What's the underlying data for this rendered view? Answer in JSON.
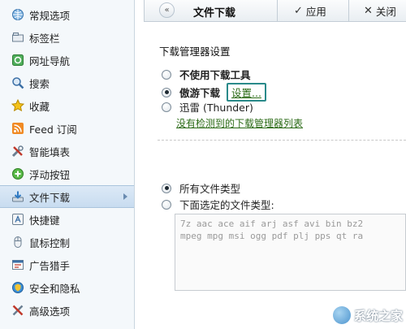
{
  "sidebar": {
    "items": [
      {
        "label": "常规选项",
        "icon": "globe-icon"
      },
      {
        "label": "标签栏",
        "icon": "tab-icon"
      },
      {
        "label": "网址导航",
        "icon": "navigation-icon"
      },
      {
        "label": "搜索",
        "icon": "search-icon"
      },
      {
        "label": "收藏",
        "icon": "star-icon"
      },
      {
        "label": "Feed 订阅",
        "icon": "rss-icon"
      },
      {
        "label": "智能填表",
        "icon": "tools-icon"
      },
      {
        "label": "浮动按钮",
        "icon": "plus-circle-icon"
      },
      {
        "label": "文件下载",
        "icon": "download-icon",
        "active": true
      },
      {
        "label": "快捷键",
        "icon": "keyboard-icon"
      },
      {
        "label": "鼠标控制",
        "icon": "mouse-icon"
      },
      {
        "label": "广告猎手",
        "icon": "ad-hunter-icon"
      },
      {
        "label": "安全和隐私",
        "icon": "shield-icon"
      },
      {
        "label": "高级选项",
        "icon": "advanced-tools-icon"
      }
    ]
  },
  "header": {
    "back_glyph": "«",
    "title": "文件下载",
    "apply_label": "应用",
    "apply_glyph": "✓",
    "close_label": "关闭",
    "close_glyph": "✕"
  },
  "download_manager": {
    "section_title": "下载管理器设置",
    "options": [
      {
        "label": "不使用下载工具",
        "checked": false,
        "bold": true
      },
      {
        "label": "傲游下载",
        "checked": true,
        "bold": true
      },
      {
        "label": "迅雷 (Thunder)",
        "checked": false,
        "bold": false
      }
    ],
    "settings_link": "设置...",
    "undetected_link": "没有检测到的下载管理器列表"
  },
  "file_types": {
    "options": [
      {
        "label": "所有文件类型",
        "checked": true
      },
      {
        "label": "下面选定的文件类型:",
        "checked": false
      }
    ],
    "extensions_line1": "7z aac ace aif arj asf avi bin bz2",
    "extensions_line2": "mpeg mpg msi ogg pdf plj pps qt ra"
  },
  "watermark": {
    "text": "系统之家"
  },
  "colors": {
    "link": "#2a6a15",
    "active_item": "#c8dcf0",
    "highlight_border": "#2a8a8a"
  }
}
